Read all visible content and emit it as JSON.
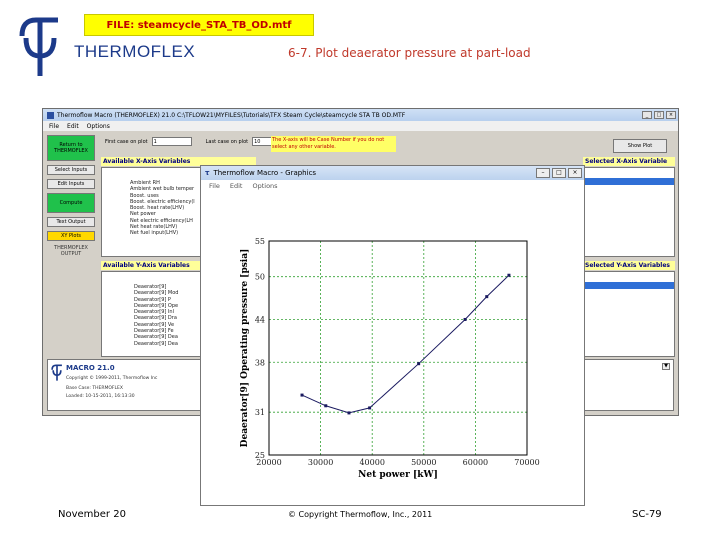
{
  "slide": {
    "file_badge": "FILE: steamcycle_STA_TB_OD.mtf",
    "brand": "THERMOFLEX",
    "title": "6-7. Plot deaerator pressure at part-load",
    "footer_left": "November 20",
    "footer_center": "© Copyright Thermoflow, Inc., 2011",
    "footer_right": "SC-79",
    "colors": {
      "brand": "#1c3a8a",
      "title": "#c0392b",
      "badge_bg": "#ffff00",
      "badge_text": "#c00000"
    }
  },
  "app": {
    "window_title": "Thermoflow Macro (THERMOFLEX) 21.0    C:\\TFLOW21\\MYFILES\\Tutorials\\TFX Steam Cycle\\steamcycle STA TB OD.MTF",
    "menu": [
      "File",
      "Edit",
      "Options"
    ],
    "left_buttons": {
      "return": "Return to THERMOFLEX",
      "select_inputs": "Select Inputs",
      "edit_inputs": "Edit Inputs",
      "compute": "Compute",
      "text_output": "Text Output",
      "xy_plots": "XY Plots",
      "tf_output": "THERMOFLEX OUTPUT"
    },
    "first_case_label": "First case on plot",
    "first_case_value": "1",
    "last_case_label": "Last case on plot",
    "last_case_value": "10",
    "hint": "The X-axis will be Case Number if you do not select any other variable.",
    "show_plot": "Show Plot",
    "x_vars_header": "Available X-Axis Variables",
    "selected_x_header": "Selected X-Axis Variable",
    "x_vars": [
      "Ambient RH",
      "Ambient wet bulb temper",
      "Boost. uses",
      "Boost. electric efficiency(l",
      "Boost. heat rate(LHV)",
      "Net power",
      "Net electric efficiency(LH",
      "Net heat rate(LHV)",
      "Net fuel input(LHV)"
    ],
    "y_vars_header": "Available Y-Axis Variables",
    "selected_y_header": "Selected Y-Axis Variables",
    "y_vars": [
      "Deaerator[9]",
      "Deaerator[9] Mod",
      "Deaerator[9] P",
      "Deaerator[9] Ope",
      "Deaerator[9] Inl",
      "Deaerator[9] Dra",
      "Deaerator[9] Ve",
      "Deaerator[9] Fe",
      "Deaerator[9] Dea",
      "Deaerator[9] Dea"
    ],
    "macro_panel": {
      "title": "MACRO 21.0",
      "copyright": "Copyright © 1999-2011, Thermoflow Inc",
      "base_case": "Base Case: THERMOFLEX",
      "loaded": "Loaded: 10-15-2011, 16:13:30"
    }
  },
  "graphics": {
    "window_title": "Thermoflow Macro - Graphics",
    "menu": [
      "File",
      "Edit",
      "Options"
    ],
    "colors": {
      "line": "#1a1a60",
      "grid": "#32a032",
      "axis": "#000000"
    }
  },
  "chart_data": {
    "type": "line",
    "title": "",
    "xlabel": "Net power [kW]",
    "ylabel": "Deaerator[9] Operating pressure [psia]",
    "xlim": [
      20000,
      70000
    ],
    "ylim": [
      25,
      55
    ],
    "xticks": [
      20000,
      30000,
      40000,
      50000,
      60000,
      70000
    ],
    "yticks": [
      25,
      31,
      38,
      44,
      50,
      55
    ],
    "grid": true,
    "series": [
      {
        "x": [
          26400,
          31000,
          35500,
          39500,
          49000,
          58000,
          62200,
          66500
        ],
        "y": [
          33.4,
          31.9,
          30.9,
          31.6,
          37.8,
          44.0,
          47.2,
          50.2
        ]
      }
    ]
  }
}
